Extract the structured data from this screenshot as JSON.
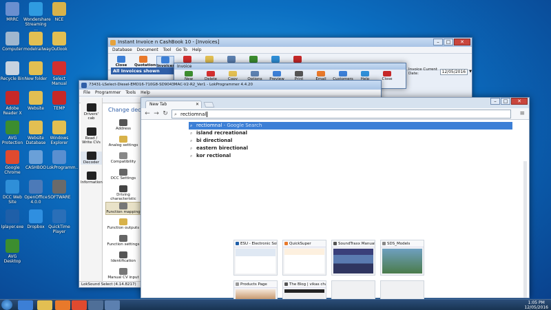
{
  "desktop": {
    "icons": [
      {
        "label": "MRRC",
        "color": "#6a8fcf"
      },
      {
        "label": "Wondershare Streaming ...",
        "color": "#2f9be0"
      },
      {
        "label": "NCE",
        "color": "#d8b24a"
      },
      {
        "label": "Computer",
        "color": "#9fb7cf"
      },
      {
        "label": "modelrailway",
        "color": "#e2bf52"
      },
      {
        "label": "Outlook",
        "color": "#e2bf52"
      },
      {
        "label": "Recycle Bin",
        "color": "#c7d3e0"
      },
      {
        "label": "New folder",
        "color": "#e2bf52"
      },
      {
        "label": "Select Manual",
        "color": "#d32f2f"
      },
      {
        "label": "Adobe Reader X",
        "color": "#c62828"
      },
      {
        "label": "Website",
        "color": "#e2bf52"
      },
      {
        "label": "TEMP",
        "color": "#c62828"
      },
      {
        "label": "AVG Protection",
        "color": "#3c8d2f"
      },
      {
        "label": "Website Database",
        "color": "#e2bf52"
      },
      {
        "label": "Windows Explorer",
        "color": "#e2bf52"
      },
      {
        "label": "Google Chrome",
        "color": "#e04a2f"
      },
      {
        "label": "CASHBOO",
        "color": "#6aa0d8"
      },
      {
        "label": "LokProgramm...",
        "color": "#5a8fd0"
      },
      {
        "label": "DCC Web Site",
        "color": "#2f8fd8"
      },
      {
        "label": "OpenOffice 4.0.0",
        "color": "#4c7ab8"
      },
      {
        "label": "SOFTWARE",
        "color": "#6a6a6a"
      },
      {
        "label": "Iplayer.exe",
        "color": "#1f5fa8"
      },
      {
        "label": "Dropbox",
        "color": "#2f8fe0"
      },
      {
        "label": "QuickTime Player",
        "color": "#2a6fb8"
      },
      {
        "label": "AVG Desktop",
        "color": "#3c8d2f"
      }
    ]
  },
  "cashbook": {
    "title": "Instant Invoice n CashBook 10 - [Invoices]",
    "menu": [
      "Database",
      "Document",
      "Tool",
      "Go To",
      "Help"
    ],
    "toolbar": [
      "Close",
      "Quotations",
      "Invoices",
      "CashBook",
      "Customers",
      "Reports",
      "MailEmPDF",
      "Help",
      "Exit"
    ],
    "panel_title": "All Invoices shown",
    "invoice_date_label": "Invoice Current Date:",
    "invoice_date": "12/05/2016"
  },
  "invoice_sub": {
    "title": "Invoice",
    "toolbar": [
      "New",
      "Delete",
      "Copy",
      "Options",
      "Preview",
      "Print",
      "Email",
      "Customers",
      "Help",
      "Close"
    ]
  },
  "lokprog": {
    "title": "73431-LSelect-Diesel-EMD16-710G8-SD9043MAC-V2-R2_Ver1 - LokProgrammer 4.4.20",
    "menu": [
      "File",
      "Programmer",
      "Tools",
      "Help"
    ],
    "header": "Change decoder",
    "sidebar": [
      "Drivers' cab",
      "Read / Write CVs",
      "Decoder",
      "Information"
    ],
    "items": [
      "Address",
      "Analog settings",
      "Compatibility",
      "DCC Settings",
      "Driving characteristic",
      "Function mapping",
      "Function outputs",
      "Function settings",
      "Identification",
      "Manual CV input"
    ],
    "status": "LokSound Select (4.14.8217)"
  },
  "chrome": {
    "tab_title": "New Tab",
    "omnibox_value": "rectiomnal",
    "suggestions": [
      {
        "text": "rectiomnal",
        "hint": " - Google Search"
      },
      {
        "text": "island recreational"
      },
      {
        "text": "bi directional"
      },
      {
        "text": "eastern birectional"
      },
      {
        "text": "kor rectional"
      }
    ],
    "thumbs": [
      {
        "title": "ESU - Electronic Solu",
        "fav": "#1f5fa8"
      },
      {
        "title": "QuickSuper",
        "fav": "#e8792b"
      },
      {
        "title": "SoundTraxx Manuals",
        "fav": "#555555"
      },
      {
        "title": "SDS_Models",
        "fav": "#888888"
      },
      {
        "title": "Products Page",
        "fav": "#999999"
      },
      {
        "title": "The Blog | vikas chan",
        "fav": "#555555"
      }
    ]
  },
  "taskbar": {
    "time": "1:05 PM",
    "date": "12/05/2016"
  }
}
